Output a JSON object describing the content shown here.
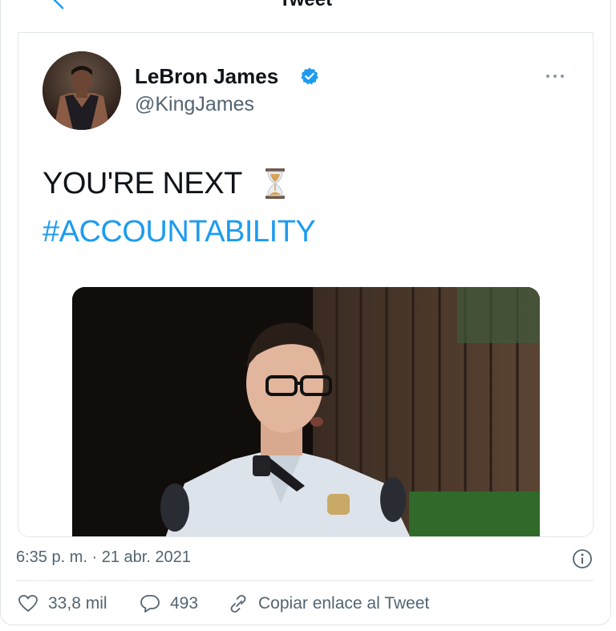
{
  "header": {
    "title": "Tweet"
  },
  "tweet": {
    "author_name": "LeBron James",
    "author_handle": "@KingJames",
    "text_line1": "YOU'RE NEXT",
    "hashtag": "#ACCOUNTABILITY",
    "timestamp": "6:35 p. m. · 21 abr. 2021"
  },
  "actions": {
    "likes": "33,8 mil",
    "replies": "493",
    "copy_link": "Copiar enlace al Tweet"
  },
  "colors": {
    "link": "#1d9bf0",
    "secondary_text": "#536471",
    "border": "#e3e7ea"
  },
  "icons": [
    "back-arrow-icon",
    "verified-badge-icon",
    "more-icon",
    "hourglass-icon",
    "info-icon",
    "heart-icon",
    "reply-icon",
    "link-icon"
  ]
}
